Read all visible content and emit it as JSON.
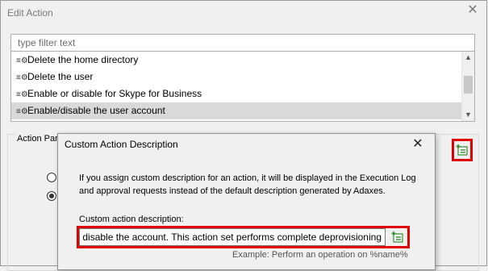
{
  "window": {
    "title": "Edit Action",
    "close_glyph": "✕"
  },
  "filter": {
    "placeholder": "type filter text",
    "value": ""
  },
  "actions": [
    {
      "label": "Delete the home directory",
      "selected": false
    },
    {
      "label": "Delete the user",
      "selected": false
    },
    {
      "label": "Enable or disable for Skype for Business",
      "selected": false
    },
    {
      "label": "Enable/disable the user account",
      "selected": true
    }
  ],
  "parameters_group": {
    "label": "Action Para"
  },
  "dialog": {
    "title": "Custom Action Description",
    "close_glyph": "✕",
    "description": "If you assign custom description for an action, it will be displayed in the Execution Log and approval requests instead of the default description generated by Adaxes.",
    "field_label": "Custom action description:",
    "field_value": "e user: disable the account. This action set performs complete deprovisioning",
    "example": "Example: Perform an operation on %name%"
  },
  "colors": {
    "highlight": "#e00000",
    "selected_row": "#d9d9d9",
    "icon_green": "#2e8b2e"
  },
  "icons": {
    "action_icon": "gear-icon",
    "custom_description_icon": "add-description-icon"
  }
}
